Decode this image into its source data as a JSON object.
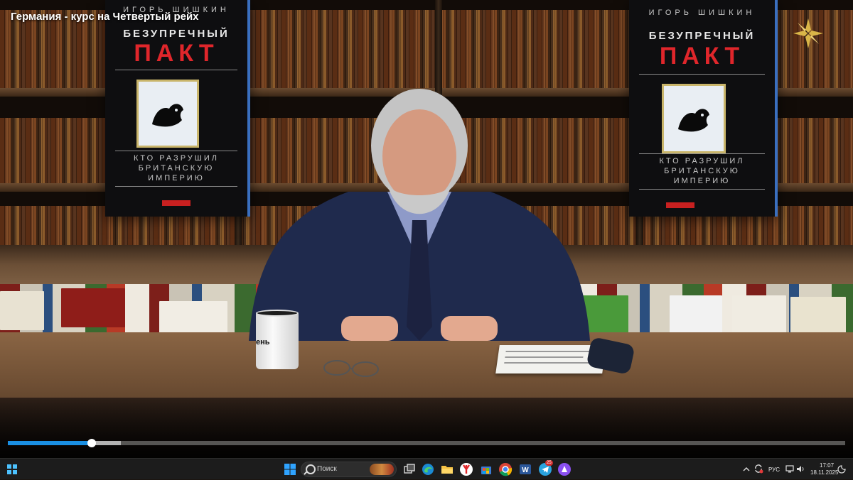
{
  "video": {
    "title": "Германия - курс на Четвертый рейх",
    "progress_fraction": 0.1,
    "buffered_fraction": 0.135
  },
  "posters": {
    "author": "ИГОРЬ ШИШКИН",
    "title_line1": "БЕЗУПРЕЧНЫЙ",
    "title_line2": "ПАКТ",
    "subtitle": [
      "КТО РАЗРУШИЛ",
      "БРИТАНСКУЮ",
      "ИМПЕРИЮ"
    ]
  },
  "scene": {
    "mug_text": "ень"
  },
  "taskbar": {
    "search_placeholder": "Поиск",
    "telegram_badge": "25",
    "language": "РУС",
    "time": "17:07",
    "date": "18.11.2025"
  },
  "colors": {
    "accent": "#1a8fe3",
    "poster_red": "#e0262b",
    "taskbar_bg": "#1c1c1c"
  },
  "icons": [
    "widgets-icon",
    "windows-start-icon",
    "search-icon",
    "task-view-icon",
    "edge-icon",
    "file-explorer-icon",
    "yandex-browser-icon",
    "store-icon",
    "chrome-icon",
    "word-icon",
    "telegram-icon",
    "alice-icon",
    "tray-chevron-icon",
    "sync-icon",
    "network-icon",
    "volume-icon",
    "notification-icon"
  ]
}
